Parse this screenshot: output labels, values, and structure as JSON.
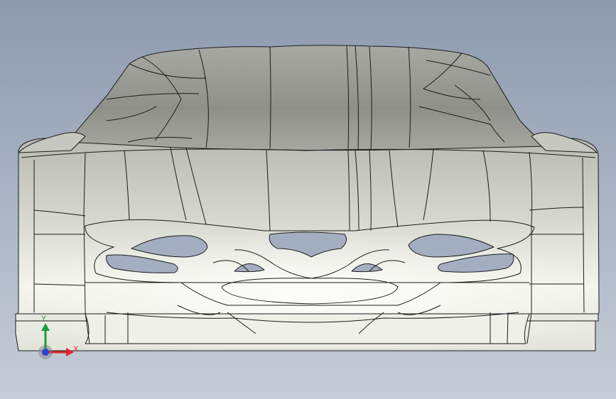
{
  "viewport": {
    "background_top": "#8e9bb0",
    "background_bottom": "#c4ccd8",
    "model_fill": "#d8d9d0",
    "edge_color": "#1b1b1b"
  },
  "triad": {
    "x_label": "X",
    "y_label": "Y",
    "x_color": "#d92a2a",
    "y_color": "#1f9b3a",
    "z_color": "#2a3fd9"
  }
}
